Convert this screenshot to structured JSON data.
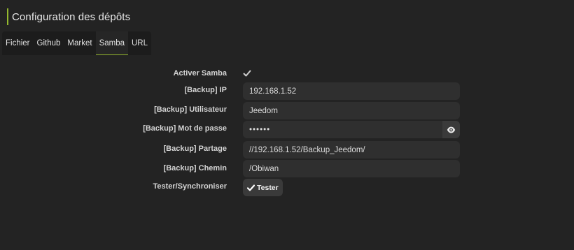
{
  "header": {
    "title": "Configuration des dépôts"
  },
  "tabs": [
    {
      "label": "Fichier",
      "active": false
    },
    {
      "label": "Github",
      "active": false
    },
    {
      "label": "Market",
      "active": false
    },
    {
      "label": "Samba",
      "active": true
    },
    {
      "label": "URL",
      "active": false
    }
  ],
  "form": {
    "activer_samba": {
      "label": "Activer Samba",
      "checked": true,
      "icon": "checkmark-icon"
    },
    "ip": {
      "label": "[Backup] IP",
      "value": "192.168.1.52"
    },
    "utilisateur": {
      "label": "[Backup] Utilisateur",
      "value": "Jeedom"
    },
    "mot_de_passe": {
      "label": "[Backup] Mot de passe",
      "value": "••••••",
      "icon": "eye-icon"
    },
    "partage": {
      "label": "[Backup] Partage",
      "value": "//192.168.1.52/Backup_Jeedom/"
    },
    "chemin": {
      "label": "[Backup] Chemin",
      "value": "/Obiwan"
    },
    "tester": {
      "label": "Tester/Synchroniser",
      "button_label": "Tester",
      "icon": "checkmark-icon"
    }
  },
  "colors": {
    "accent": "#94b82e",
    "background": "#232323",
    "field": "#2f2f2f"
  }
}
